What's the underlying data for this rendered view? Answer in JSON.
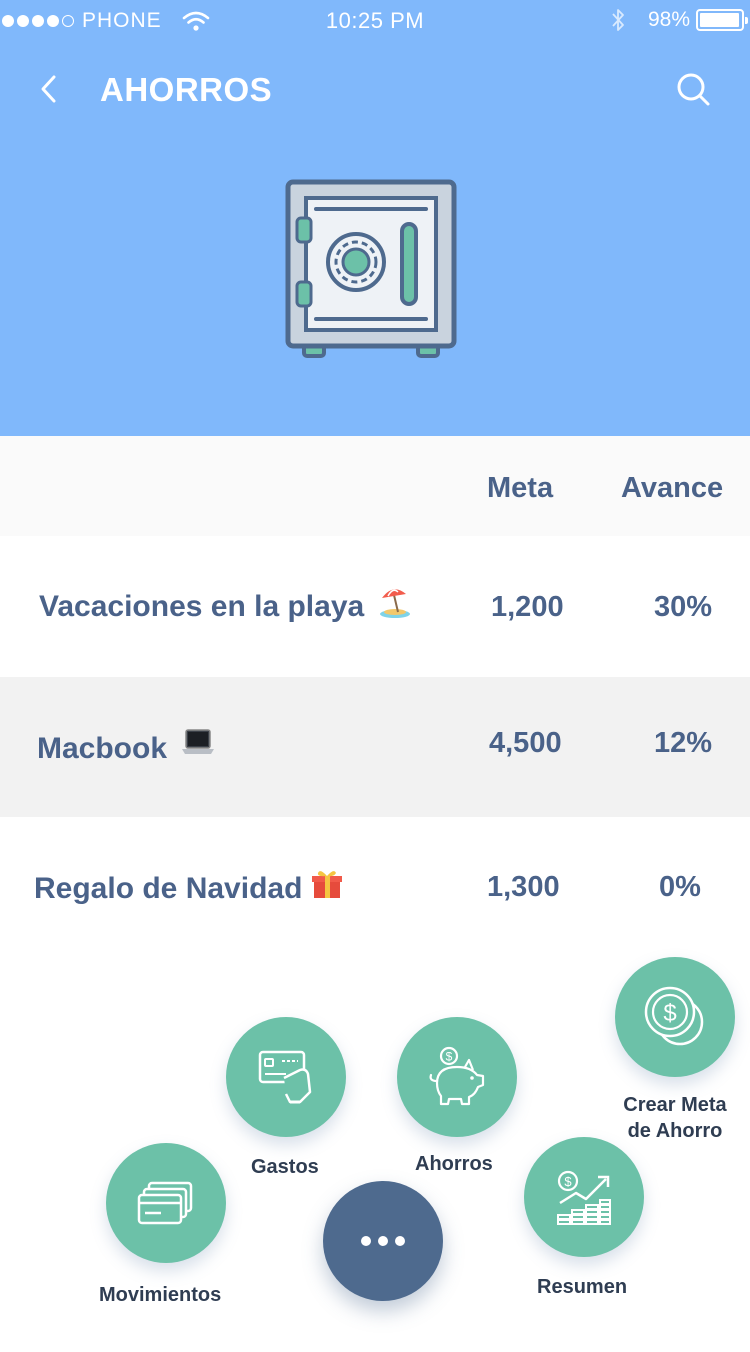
{
  "status_bar": {
    "carrier": "PHONE",
    "signal_bars_filled": 4,
    "signal_bars_total": 5,
    "time": "10:25 PM",
    "battery": "98%",
    "battery_level": 0.98
  },
  "nav": {
    "title": "AHORROS",
    "back_icon": "chevron-left-icon",
    "search_icon": "search-icon"
  },
  "hero": {
    "icon": "safe-icon"
  },
  "table": {
    "headers": {
      "name": "",
      "meta": "Meta",
      "avance": "Avance"
    },
    "rows": [
      {
        "name": "Vacaciones en la playa",
        "emoji": "beach-umbrella-icon",
        "meta": "1,200",
        "avance": "30%"
      },
      {
        "name": "Macbook",
        "emoji": "laptop-icon",
        "meta": "4,500",
        "avance": "12%"
      },
      {
        "name": "Regalo de Navidad",
        "emoji": "gift-icon",
        "meta": "1,300",
        "avance": "0%"
      }
    ]
  },
  "fab_menu": {
    "items": [
      {
        "label": "Movimientos",
        "icon": "cards-icon"
      },
      {
        "label": "Gastos",
        "icon": "card-payment-icon"
      },
      {
        "label": "Ahorros",
        "icon": "piggy-bank-icon"
      },
      {
        "label": "Resumen",
        "icon": "growth-chart-icon"
      },
      {
        "label_line1": "Crear Meta",
        "label_line2": "de Ahorro",
        "icon": "coins-icon"
      }
    ],
    "main_button_icon": "more-dots-icon"
  },
  "colors": {
    "header_bg": "#80b8fb",
    "text_primary": "#4a6289",
    "accent_green": "#6cc1a8",
    "fab_main": "#4e6a8e"
  }
}
